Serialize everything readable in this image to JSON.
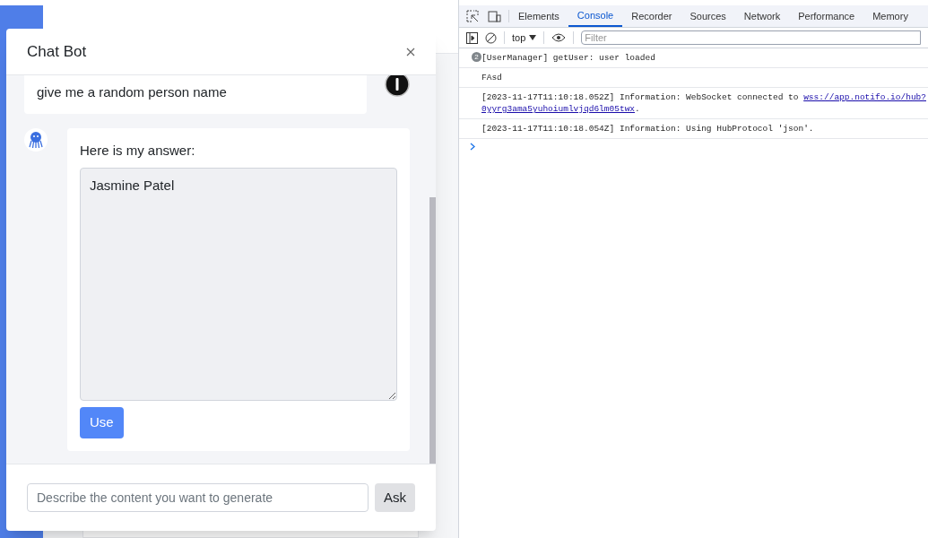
{
  "chat": {
    "title": "Chat Bot",
    "messages": [
      {
        "kind": "user",
        "text": "give me a random person name"
      },
      {
        "kind": "bot",
        "intro": "Here is my answer:",
        "answer": "Jasmine Patel",
        "action": "Use"
      }
    ],
    "input": {
      "placeholder": "Describe the content you want to generate"
    },
    "send": "Ask"
  },
  "devtools": {
    "tabs": [
      {
        "label": "Elements",
        "selected": false
      },
      {
        "label": "Console",
        "selected": true
      },
      {
        "label": "Recorder",
        "selected": false
      },
      {
        "label": "Sources",
        "selected": false
      },
      {
        "label": "Network",
        "selected": false
      },
      {
        "label": "Performance",
        "selected": false
      },
      {
        "label": "Memory",
        "selected": false
      }
    ],
    "context": "top",
    "filter": {
      "placeholder": "Filter"
    },
    "messages": [
      {
        "count": "2",
        "text": "[UserManager] getUser: user loaded"
      },
      {
        "text": "FAsd"
      },
      {
        "text": "[2023-11-17T11:10:18.052Z] Information: WebSocket connected to ",
        "link": [
          "wss://app.notifo.io/hub?",
          "0yyrg3ama5yuhoiumlvjqd6lm05twx"
        ],
        "after": "."
      },
      {
        "text": "[2023-11-17T11:10:18.054Z] Information: Using HubProtocol 'json'."
      }
    ]
  }
}
